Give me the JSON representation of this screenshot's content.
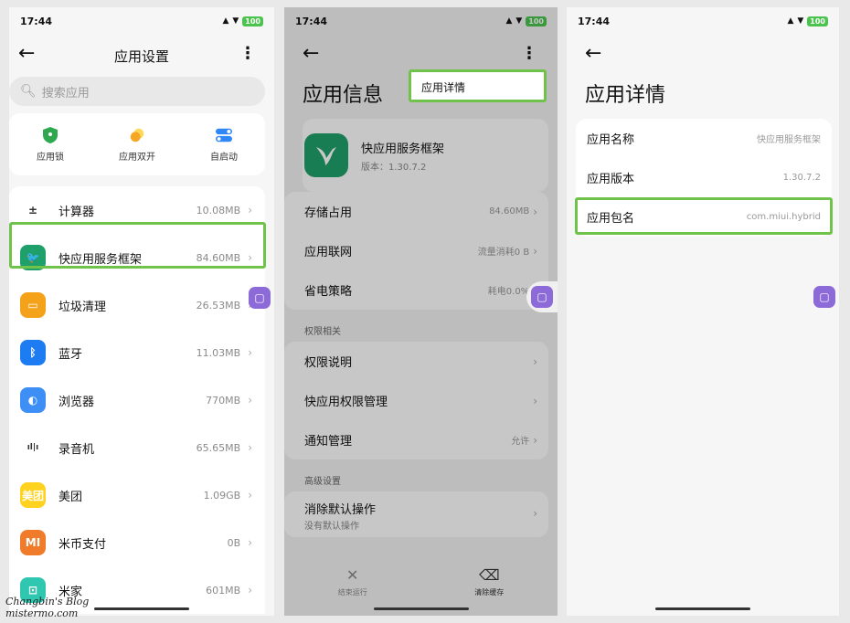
{
  "status": {
    "time": "17:44",
    "battery": "100"
  },
  "panel1": {
    "title": "应用设置",
    "search_placeholder": "搜索应用",
    "quick": [
      {
        "label": "应用锁",
        "icon": "shield-icon",
        "color": "#2fa84f"
      },
      {
        "label": "应用双开",
        "icon": "dual-circles-icon",
        "color": "#f5a623"
      },
      {
        "label": "自启动",
        "icon": "toggle-icon",
        "color": "#2f86f6"
      }
    ],
    "apps": [
      {
        "name": "计算器",
        "size": "10.08MB",
        "icon": "calculator-icon",
        "color": "#ffffff",
        "glyph": "±"
      },
      {
        "name": "快应用服务框架",
        "size": "84.60MB",
        "icon": "hummingbird-icon",
        "color": "#1fa06a",
        "glyph": "🐦"
      },
      {
        "name": "垃圾清理",
        "size": "26.53MB",
        "icon": "trash-icon",
        "color": "#f5a21b",
        "glyph": "▭"
      },
      {
        "name": "蓝牙",
        "size": "11.03MB",
        "icon": "bluetooth-icon",
        "color": "#1d7cf2",
        "glyph": "ᛒ"
      },
      {
        "name": "浏览器",
        "size": "770MB",
        "icon": "browser-icon",
        "color": "#3d8ff5",
        "glyph": "◐"
      },
      {
        "name": "录音机",
        "size": "65.65MB",
        "icon": "recorder-icon",
        "color": "#ffffff",
        "glyph": "ıl|ı"
      },
      {
        "name": "美团",
        "size": "1.09GB",
        "icon": "meituan-icon",
        "color": "#ffd21f",
        "glyph": "美团"
      },
      {
        "name": "米币支付",
        "size": "0B",
        "icon": "mi-coin-icon",
        "color": "#f07b2b",
        "glyph": "MI"
      },
      {
        "name": "米家",
        "size": "601MB",
        "icon": "mijia-icon",
        "color": "#2fc7b0",
        "glyph": "⊡"
      }
    ]
  },
  "panel2": {
    "title": "应用信息",
    "popup_item": "应用详情",
    "app_name": "快应用服务框架",
    "version": "版本：1.30.7.2",
    "rows1": [
      {
        "label": "存储占用",
        "value": "84.60MB"
      },
      {
        "label": "应用联网",
        "value": "流量消耗0 B"
      },
      {
        "label": "省电策略",
        "value": "耗电0.0%"
      }
    ],
    "section_perm": "权限相关",
    "rows2": [
      {
        "label": "权限说明",
        "value": ""
      },
      {
        "label": "快应用权限管理",
        "value": ""
      },
      {
        "label": "通知管理",
        "value": "允许"
      }
    ],
    "section_adv": "高级设置",
    "default_title": "消除默认操作",
    "default_sub": "没有默认操作",
    "actions": [
      {
        "label": "结束运行",
        "icon": "close-icon"
      },
      {
        "label": "清除缓存",
        "icon": "eraser-icon"
      }
    ]
  },
  "panel3": {
    "title": "应用详情",
    "rows": [
      {
        "label": "应用名称",
        "value": "快应用服务框架"
      },
      {
        "label": "应用版本",
        "value": "1.30.7.2"
      },
      {
        "label": "应用包名",
        "value": "com.miui.hybrid"
      }
    ]
  },
  "watermark": {
    "line1": "Changbin's Blog",
    "line2": "mistermo.com"
  }
}
